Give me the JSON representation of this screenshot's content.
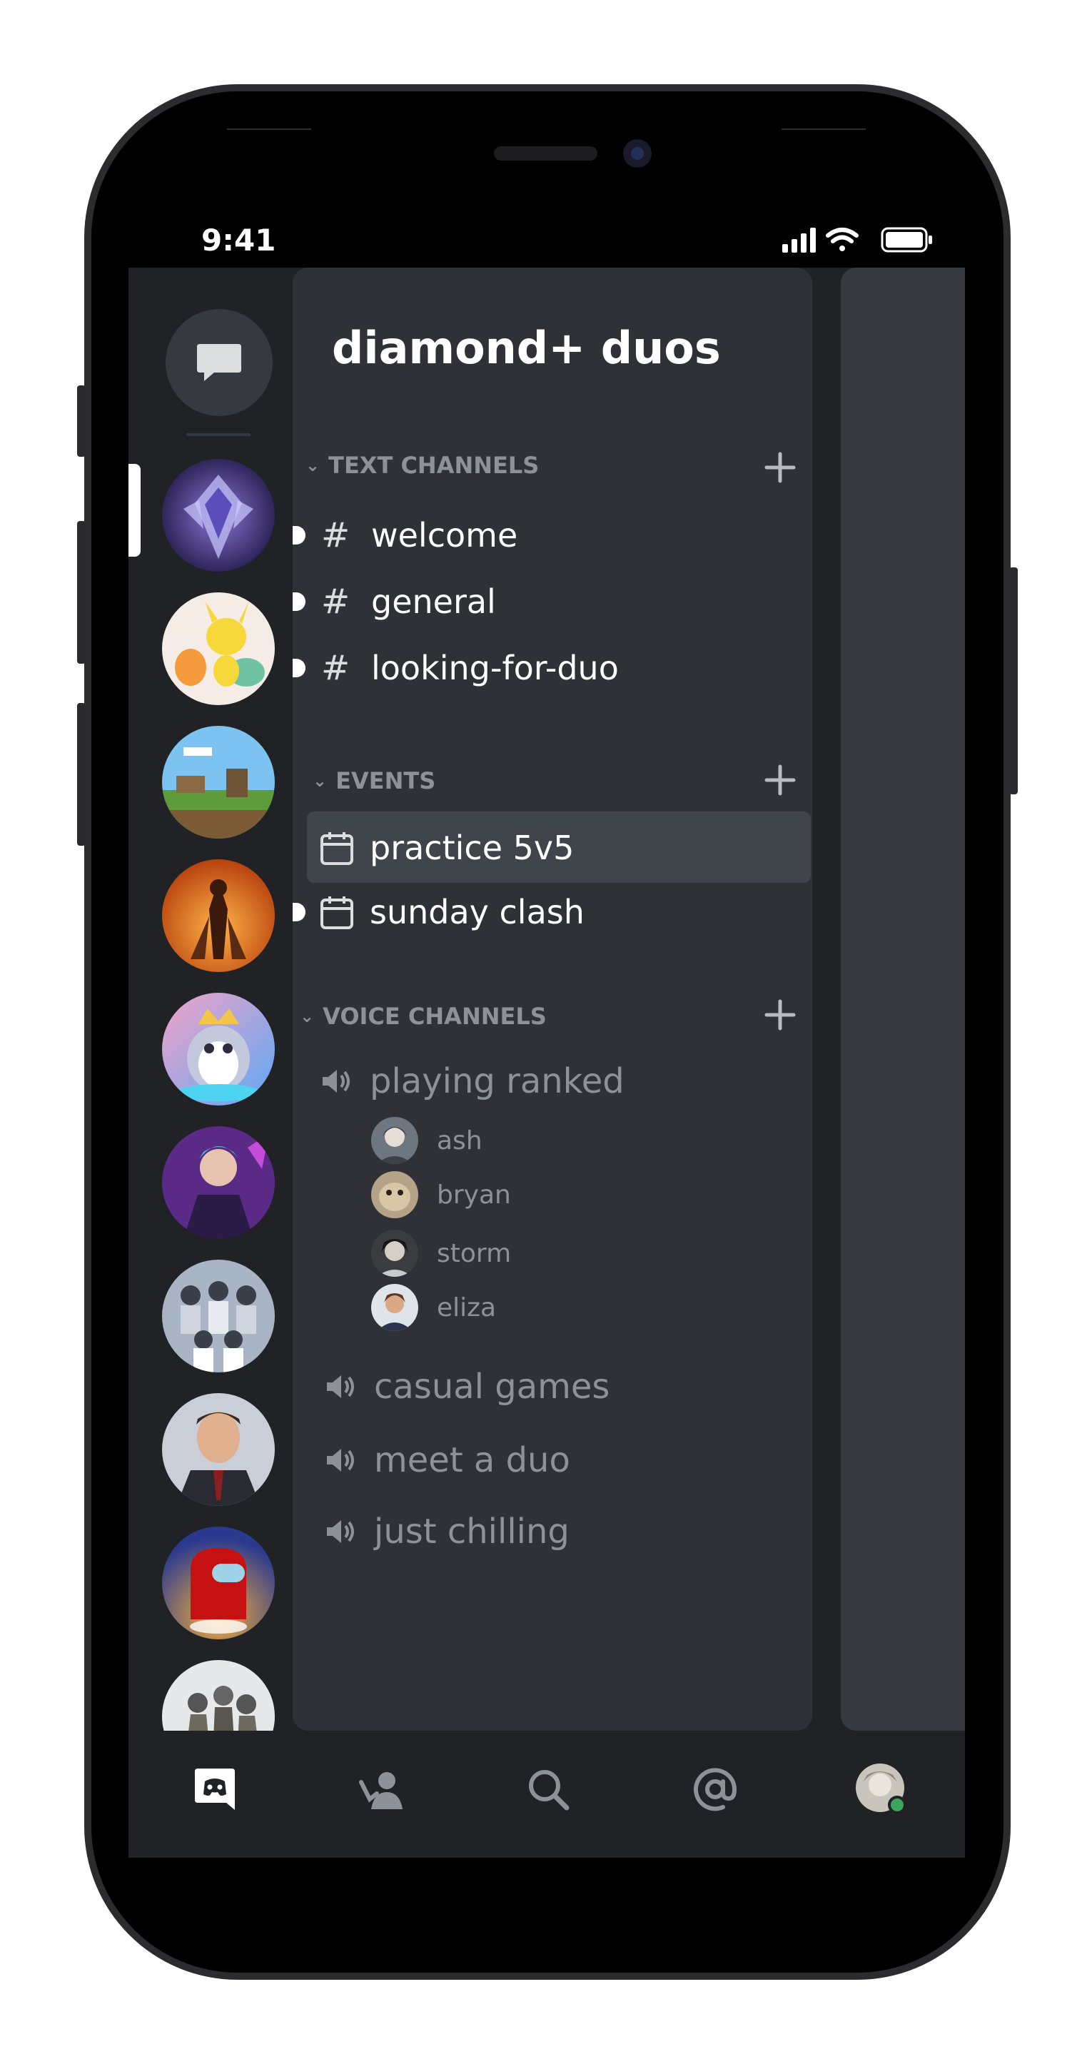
{
  "status_bar": {
    "time": "9:41"
  },
  "server": {
    "name": "diamond+ duos"
  },
  "categories": {
    "text": {
      "label": "TEXT CHANNELS"
    },
    "events": {
      "label": "EVENTS"
    },
    "voice": {
      "label": "VOICE CHANNELS"
    }
  },
  "text_channels": [
    "welcome",
    "general",
    "looking-for-duo"
  ],
  "events": [
    "practice 5v5",
    "sunday clash"
  ],
  "voice_channels": [
    {
      "name": "playing ranked",
      "members": [
        "ash",
        "bryan",
        "storm",
        "eliza"
      ]
    },
    {
      "name": "casual games"
    },
    {
      "name": "meet a duo"
    },
    {
      "name": "just chilling"
    }
  ],
  "server_list": [
    {
      "icon": "diamond-rank-emblem-icon"
    },
    {
      "icon": "pokemon-starters-icon"
    },
    {
      "icon": "minecraft-landscape-icon"
    },
    {
      "icon": "anime-fire-icon"
    },
    {
      "icon": "penguin-mascot-icon"
    },
    {
      "icon": "valorant-agent-icon"
    },
    {
      "icon": "group-photo-icon"
    },
    {
      "icon": "office-man-icon"
    },
    {
      "icon": "among-us-icon"
    },
    {
      "icon": "apex-squad-icon"
    }
  ],
  "tab_bar": [
    "discord-home-icon",
    "friends-icon",
    "search-icon",
    "mentions-icon",
    "profile-avatar-icon"
  ],
  "colors": {
    "background": "#202225",
    "panel": "#2f3136",
    "selected": "#40444b",
    "muted_text": "#8e9297",
    "online": "#3ba55d"
  }
}
